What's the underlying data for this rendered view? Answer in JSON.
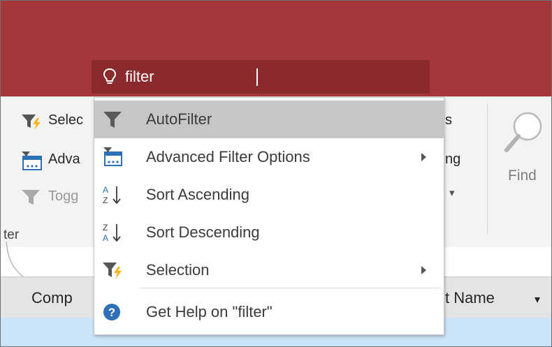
{
  "tell_me": {
    "query": "filter"
  },
  "ribbon": {
    "left_items": [
      "Selec",
      "Adva",
      "Togg"
    ],
    "group_label": "ter",
    "right_items": [
      "s",
      "ng",
      "▾"
    ],
    "find_label": "Find"
  },
  "table": {
    "headers": [
      "Comp",
      "t Name"
    ],
    "sort_glyph": "▾"
  },
  "menu": {
    "items": [
      {
        "label": "AutoFilter",
        "icon": "filter-icon",
        "submenu": false,
        "highlighted": true
      },
      {
        "label": "Advanced Filter Options",
        "icon": "advanced-filter-icon",
        "submenu": true
      },
      {
        "label": "Sort Ascending",
        "icon": "sort-ascending-icon",
        "submenu": false
      },
      {
        "label": "Sort Descending",
        "icon": "sort-descending-icon",
        "submenu": false
      },
      {
        "label": "Selection",
        "icon": "selection-filter-icon",
        "submenu": true
      },
      {
        "label": "Get Help on \"filter\"",
        "icon": "help-icon",
        "submenu": false
      }
    ]
  },
  "colors": {
    "titlebar": "#a4373a",
    "tell_me_box": "#8b2a2d",
    "menu_highlight": "#c6c6c6",
    "selected_row": "#cce4f7"
  }
}
